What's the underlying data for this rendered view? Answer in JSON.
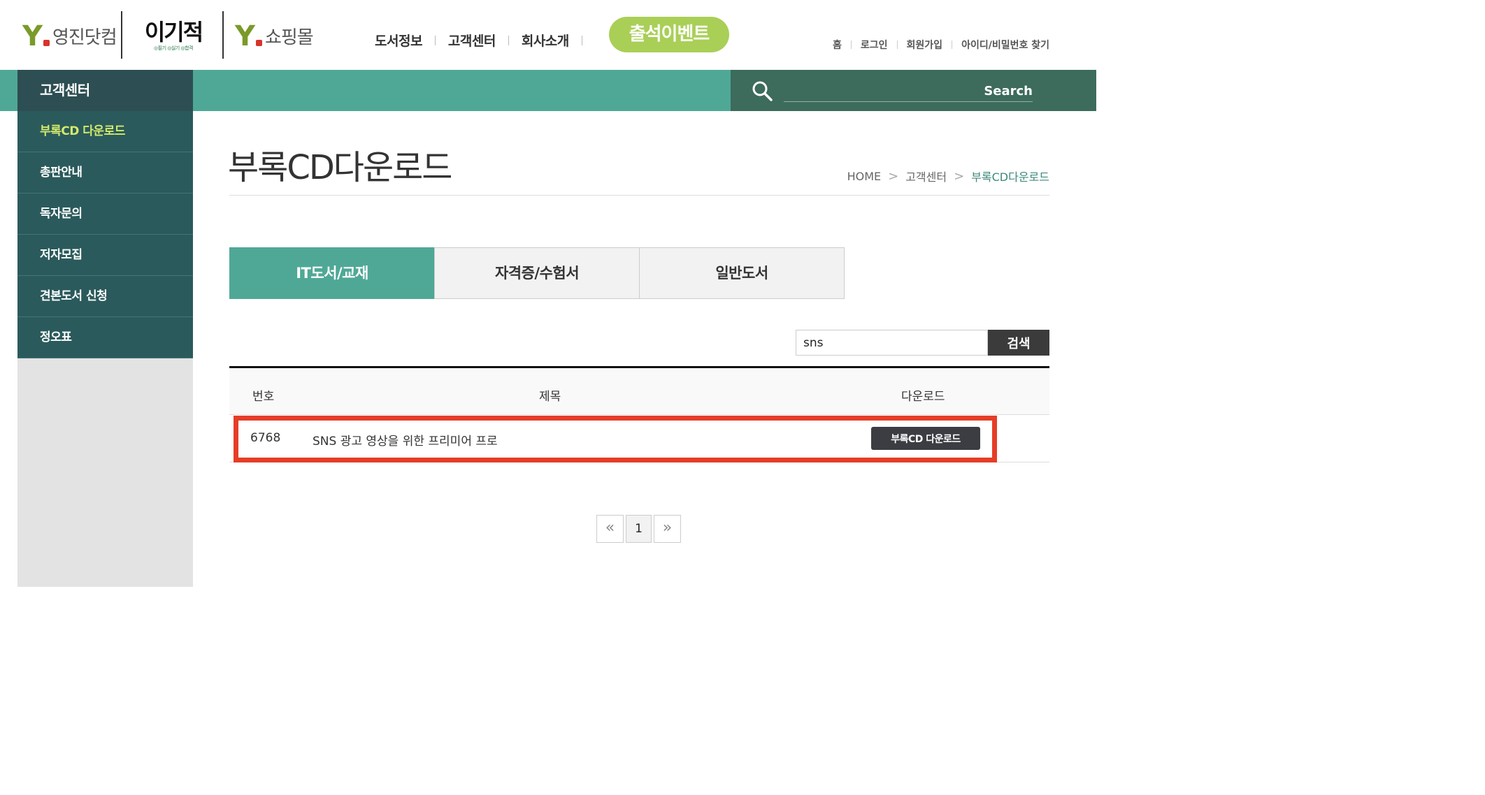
{
  "header": {
    "logo_yeongjin": "영진닷컴",
    "logo_igijeok": "이기적",
    "logo_igijeok_sub": "◎필기 ◎실기 ◎합격",
    "logo_shopping": "쇼핑몰",
    "logo_y": "Y",
    "gnb": [
      "도서정보",
      "고객센터",
      "회사소개"
    ],
    "event_label": "출석이벤트",
    "util": [
      "홈",
      "로그인",
      "회원가입",
      "아이디/비밀번호 찾기"
    ]
  },
  "bar": {
    "section_title": "고객센터",
    "search_placeholder": "Search",
    "search_icon": "search-icon"
  },
  "sidebar": {
    "items": [
      {
        "label": "부록CD 다운로드",
        "active": true
      },
      {
        "label": "총판안내",
        "active": false
      },
      {
        "label": "독자문의",
        "active": false
      },
      {
        "label": "저자모집",
        "active": false
      },
      {
        "label": "견본도서 신청",
        "active": false
      },
      {
        "label": "정오표",
        "active": false
      }
    ]
  },
  "main": {
    "title": "부록CD다운로드",
    "breadcrumb": [
      "HOME",
      "고객센터",
      "부록CD다운로드"
    ],
    "tabs": [
      {
        "label": "IT도서/교재",
        "active": true
      },
      {
        "label": "자격증/수험서",
        "active": false
      },
      {
        "label": "일반도서",
        "active": false
      }
    ],
    "search_value": "sns",
    "search_button": "검색",
    "table": {
      "headers": [
        "번호",
        "제목",
        "다운로드"
      ],
      "rows": [
        {
          "no": "6768",
          "title": "SNS 광고 영상을 위한 프리미어 프로",
          "button": "부록CD 다운로드"
        }
      ]
    },
    "pager": {
      "prev": "«",
      "current": "1",
      "next": "»"
    }
  },
  "colors": {
    "accent_green": "#4fa896",
    "dark_teal": "#2b5a5c",
    "event_green": "#a9cf57",
    "highlight_red": "#e63d27"
  }
}
